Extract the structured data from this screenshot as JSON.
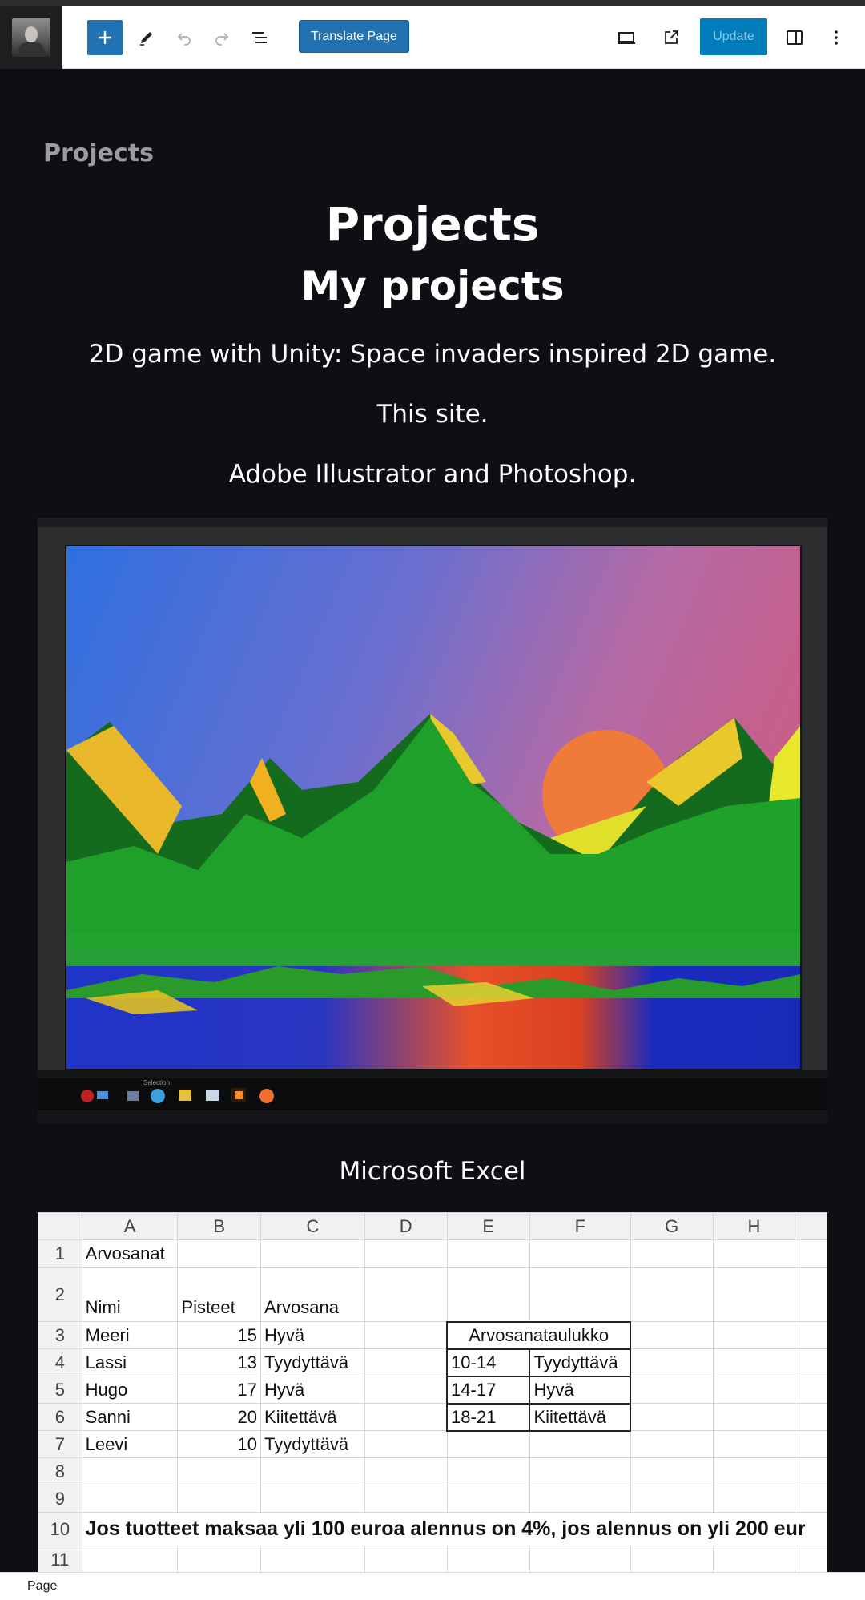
{
  "toolbar": {
    "add_label": "Add block",
    "translate_label": "Translate Page",
    "update_label": "Update"
  },
  "content": {
    "site_title": "Projects",
    "heading": "Projects",
    "subheading": "My projects",
    "paragraphs": [
      "2D game with Unity: Space invaders inspired 2D game.",
      "This site.",
      "Adobe Illustrator and Photoshop.",
      "Microsoft Excel"
    ]
  },
  "image": {
    "taskbar_label": "Selection"
  },
  "spreadsheet": {
    "columns": [
      "A",
      "B",
      "C",
      "D",
      "E",
      "F",
      "G",
      "H"
    ],
    "rows": [
      {
        "n": "1",
        "a": "Arvosanat",
        "b": "",
        "c": ""
      },
      {
        "n": "2",
        "a": "Nimi",
        "b": "Pisteet",
        "c": "Arvosana"
      },
      {
        "n": "3",
        "a": "Meeri",
        "b": "15",
        "c": "Hyvä"
      },
      {
        "n": "4",
        "a": "Lassi",
        "b": "13",
        "c": "Tyydyttävä"
      },
      {
        "n": "5",
        "a": "Hugo",
        "b": "17",
        "c": "Hyvä"
      },
      {
        "n": "6",
        "a": "Sanni",
        "b": "20",
        "c": "Kiitettävä"
      },
      {
        "n": "7",
        "a": "Leevi",
        "b": "10",
        "c": "Tyydyttävä"
      },
      {
        "n": "8",
        "a": "",
        "b": "",
        "c": ""
      },
      {
        "n": "9",
        "a": "",
        "b": "",
        "c": ""
      },
      {
        "n": "10",
        "a": "Jos tuotteet maksaa yli 100 euroa alennus on 4%, jos alennus on yli 200 eur",
        "b": "",
        "c": ""
      },
      {
        "n": "11",
        "a": "",
        "b": "",
        "c": ""
      }
    ],
    "grade_table": {
      "title": "Arvosanataulukko",
      "rows": [
        {
          "range": "10-14",
          "grade": "Tyydyttävä"
        },
        {
          "range": "14-17",
          "grade": "Hyvä"
        },
        {
          "range": "18-21",
          "grade": "Kiitettävä"
        }
      ]
    }
  },
  "footer": {
    "breadcrumb": "Page"
  },
  "colors": {
    "accent": "#2271b1",
    "canvas_bg": "#0d0f14",
    "update_bg": "#007cba"
  }
}
